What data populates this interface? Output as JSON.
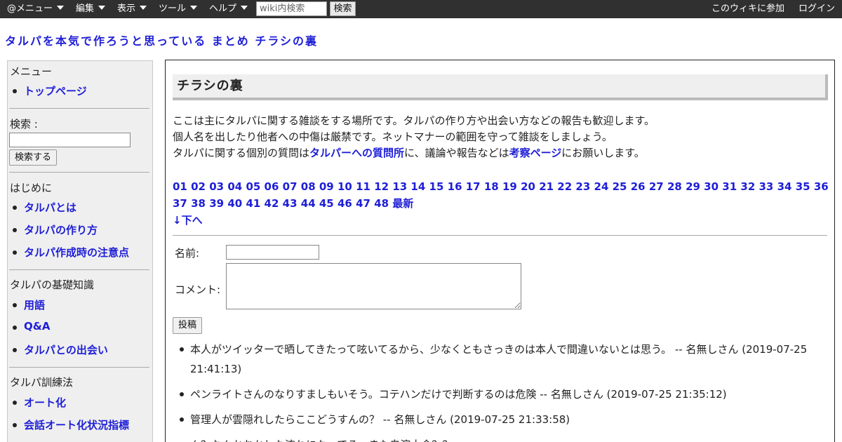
{
  "topbar": {
    "menus": [
      {
        "label": "@メニュー",
        "name": "menu-atmenu"
      },
      {
        "label": "編集",
        "name": "menu-edit"
      },
      {
        "label": "表示",
        "name": "menu-view"
      },
      {
        "label": "ツール",
        "name": "menu-tools"
      },
      {
        "label": "ヘルプ",
        "name": "menu-help"
      }
    ],
    "search_placeholder": "wiki内検索",
    "search_button": "検索",
    "join_label": "このウィキに参加",
    "login_label": "ログイン"
  },
  "site": {
    "title": "タルパを本気で作ろうと思っている まとめ チラシの裏"
  },
  "sidebar": {
    "menu_heading": "メニュー",
    "top_page": "トップページ",
    "search_label": "検索 :",
    "search_button": "検索する",
    "intro_heading": "はじめに",
    "intro_items": [
      "タルパとは",
      "タルパの作り方",
      "タルパ作成時の注意点"
    ],
    "basics_heading": "タルパの基礎知識",
    "basics_items": [
      "用語",
      "Q&A",
      "タルパとの出会い"
    ],
    "training_heading": "タルパ訓練法",
    "training_items": [
      "オート化",
      "会話オート化状況指標"
    ]
  },
  "main": {
    "heading": "チラシの裏",
    "intro_line1": "ここは主にタルパに関する雑談をする場所です。タルパの作り方や出会い方などの報告も歓迎します。",
    "intro_line2": "個人名を出したり他者への中傷は厳禁です。ネットマナーの範囲を守って雑談をしましょう。",
    "intro_line3_a": "タルパに関する個別の質問は",
    "intro_line3_link1": "タルパーへの質問所",
    "intro_line3_b": "に、議論や報告などは",
    "intro_line3_link2": "考察ページ",
    "intro_line3_c": "にお願いします。",
    "pages": [
      "01",
      "02",
      "03",
      "04",
      "05",
      "06",
      "07",
      "08",
      "09",
      "10",
      "11",
      "12",
      "13",
      "14",
      "15",
      "16",
      "17",
      "18",
      "19",
      "20",
      "21",
      "22",
      "23",
      "24",
      "25",
      "26",
      "27",
      "28",
      "29",
      "30",
      "31",
      "32",
      "33",
      "34",
      "35",
      "36",
      "37",
      "38",
      "39",
      "40",
      "41",
      "42",
      "43",
      "44",
      "45",
      "46",
      "47",
      "48",
      "最新"
    ],
    "down_link": "↓下へ",
    "name_label": "名前:",
    "comment_label": "コメント:",
    "post_button": "投稿",
    "comments": [
      "本人がツイッターで晒してきたって呟いてるから、少なくともさっきのは本人で間違いないとは思う。 -- 名無しさん (2019-07-25 21:41:13)",
      "ペンライトさんのなりすましもいそう。コテハンだけで判断するのは危険 -- 名無しさん (2019-07-25 21:35:12)",
      "管理人が雲隠れしたらここどうすんの？ -- 名無しさん (2019-07-25 21:33:58)",
      "ん？なんかおかしな流れになってる。また自演大会？？"
    ]
  }
}
